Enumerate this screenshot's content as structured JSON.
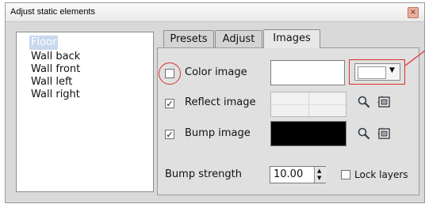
{
  "window": {
    "title": "Adjust static elements",
    "close_glyph": "×"
  },
  "elements_list": {
    "items": [
      {
        "label": "Floor",
        "selected": true
      },
      {
        "label": "Wall back",
        "selected": false
      },
      {
        "label": "Wall front",
        "selected": false
      },
      {
        "label": "Wall left",
        "selected": false
      },
      {
        "label": "Wall right",
        "selected": false
      }
    ]
  },
  "tabs": [
    {
      "label": "Presets",
      "active": false
    },
    {
      "label": "Adjust",
      "active": false
    },
    {
      "label": "Images",
      "active": true
    }
  ],
  "images_panel": {
    "color_image": {
      "label": "Color image",
      "checked": false,
      "check_glyph": "",
      "swatch_color": "#ffffff",
      "arrow_glyph": "▼"
    },
    "reflect_image": {
      "label": "Reflect image",
      "checked": true,
      "check_glyph": "✓"
    },
    "bump_image": {
      "label": "Bump image",
      "checked": true,
      "check_glyph": "✓"
    },
    "bump_strength": {
      "label": "Bump strength",
      "value": "10.00",
      "up_glyph": "▲",
      "down_glyph": "▼"
    },
    "lock_layers": {
      "label": "Lock layers",
      "checked": false
    }
  },
  "icons": {
    "zoom": "magnifier-icon",
    "load": "load-image-icon"
  },
  "colors": {
    "annotation": "#d6322c",
    "selection": "#c9d8ee"
  }
}
